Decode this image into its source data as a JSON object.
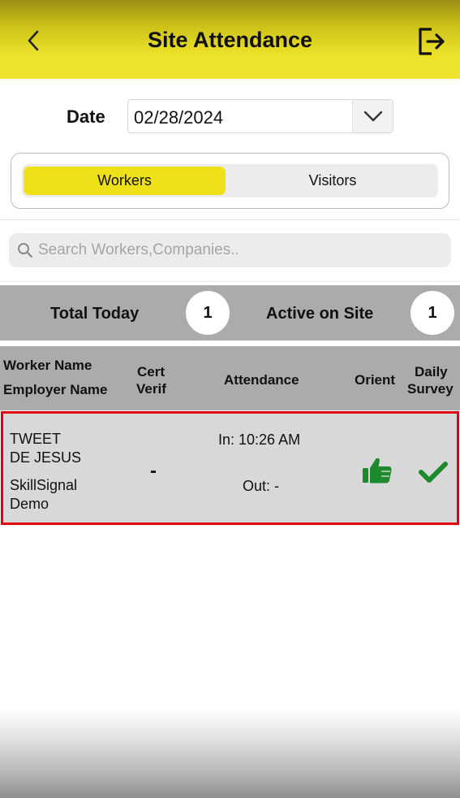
{
  "header": {
    "title": "Site Attendance",
    "back_icon": "chevron-left-icon",
    "logout_icon": "logout-icon",
    "background": "#efe118"
  },
  "date": {
    "label": "Date",
    "value": "02/28/2024",
    "dropdown_icon": "chevron-down-icon"
  },
  "segment": {
    "workers_label": "Workers",
    "visitors_label": "Visitors",
    "selected": "Workers",
    "active_color": "#efe118"
  },
  "search": {
    "placeholder": "Search Workers,Companies..",
    "value": ""
  },
  "stats": {
    "total_today_label": "Total Today",
    "total_today_value": "1",
    "active_label": "Active on Site",
    "active_value": "1"
  },
  "table": {
    "headers": {
      "worker_name": "Worker Name",
      "employer_name": "Employer Name",
      "cert_line1": "Cert",
      "cert_line2": "Verif",
      "attendance": "Attendance",
      "orient": "Orient",
      "survey_line1": "Daily",
      "survey_line2": "Survey"
    },
    "rows": [
      {
        "name_line1": "TWEET",
        "name_line2": "DE JESUS",
        "employer_line1": "SkillSignal",
        "employer_line2": "Demo",
        "cert": "-",
        "in": "In: 10:26 AM",
        "out": "Out: -",
        "orient_icon": "thumbs-up-icon",
        "survey_icon": "checkmark-icon",
        "status_color": "#1e8a2e",
        "highlight_color": "#e00014"
      }
    ]
  }
}
